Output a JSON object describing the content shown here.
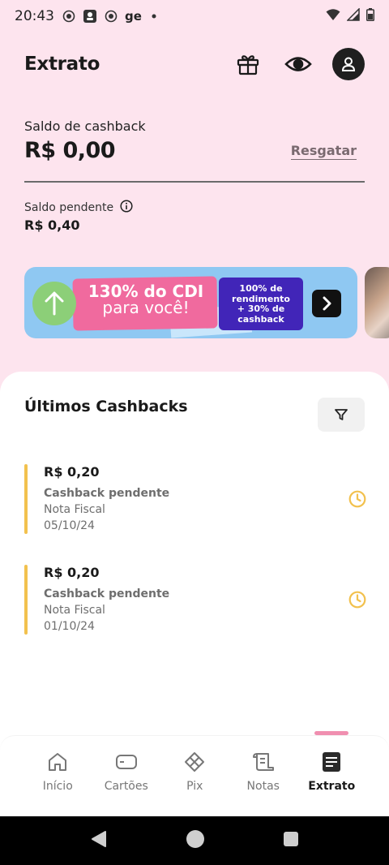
{
  "status_bar": {
    "time": "20:43",
    "extra": "ge"
  },
  "header": {
    "title": "Extrato"
  },
  "balance": {
    "label": "Saldo de cashback",
    "value": "R$ 0,00",
    "action": "Resgatar"
  },
  "pending": {
    "label": "Saldo pendente",
    "value": "R$ 0,40"
  },
  "banner": {
    "headline": "130% do CDI",
    "subline": "para você!",
    "detail_line1": "100% de",
    "detail_line2": "rendimento",
    "detail_line3": "+ 30% de",
    "detail_line4": "cashback"
  },
  "section": {
    "title": "Últimos Cashbacks"
  },
  "items": [
    {
      "amount": "R$ 0,20",
      "status": "Cashback pendente",
      "kind": "Nota Fiscal",
      "date": "05/10/24"
    },
    {
      "amount": "R$ 0,20",
      "status": "Cashback pendente",
      "kind": "Nota Fiscal",
      "date": "01/10/24"
    }
  ],
  "nav": {
    "items": [
      {
        "label": "Início",
        "icon": "home-icon"
      },
      {
        "label": "Cartões",
        "icon": "card-icon"
      },
      {
        "label": "Pix",
        "icon": "pix-icon"
      },
      {
        "label": "Notas",
        "icon": "receipt-icon"
      },
      {
        "label": "Extrato",
        "icon": "statement-icon"
      }
    ],
    "active": "Extrato"
  },
  "colors": {
    "background": "#fde4ee",
    "pending_accent": "#f2c14e",
    "nav_indicator": "#f08fb0"
  }
}
